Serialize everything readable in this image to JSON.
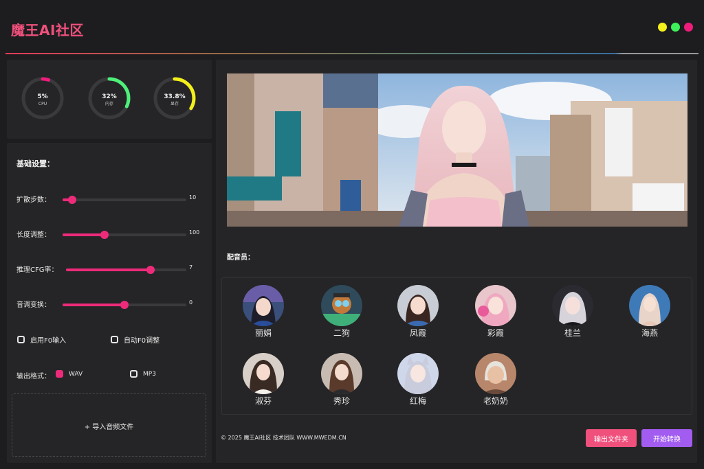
{
  "app": {
    "title": "魔王AI社区"
  },
  "window_controls": [
    {
      "name": "yellow",
      "color": "#f3f01c"
    },
    {
      "name": "green",
      "color": "#3ef05a"
    },
    {
      "name": "pink",
      "color": "#f01c7c"
    }
  ],
  "gauges": [
    {
      "value": "5%",
      "label": "CPU",
      "percent": 5,
      "color": "#f01c7c"
    },
    {
      "value": "32%",
      "label": "内存",
      "percent": 32,
      "color": "#4ef07a"
    },
    {
      "value": "33.8%",
      "label": "显存",
      "percent": 33.8,
      "color": "#f3f01c"
    }
  ],
  "settings": {
    "title": "基础设置：",
    "sliders": [
      {
        "label": "扩散步数：",
        "value": "10",
        "fraction": 0.08
      },
      {
        "label": "长度调整：",
        "value": "100",
        "fraction": 0.34
      },
      {
        "label": "推理CFG率：",
        "value": "7",
        "fraction": 0.7
      },
      {
        "label": "音调变换：",
        "value": "0",
        "fraction": 0.5
      }
    ],
    "checkboxes": [
      {
        "label": "启用F0输入",
        "checked": false
      },
      {
        "label": "自动F0调整",
        "checked": false
      }
    ],
    "output_format": {
      "label": "输出格式：",
      "options": [
        {
          "label": "WAV",
          "selected": true
        },
        {
          "label": "MP3",
          "selected": false
        }
      ]
    },
    "import_label": "+ 导入音频文件"
  },
  "voice_section": {
    "title": "配音员：",
    "voices": [
      {
        "name": "丽娟",
        "avatar": "anime-girl-avatar"
      },
      {
        "name": "二狗",
        "avatar": "robot-cartoon-avatar"
      },
      {
        "name": "凤霞",
        "avatar": "girl-denim-avatar"
      },
      {
        "name": "彩霞",
        "avatar": "pink-hair-girl-avatar"
      },
      {
        "name": "桂兰",
        "avatar": "silver-hair-girl-avatar"
      },
      {
        "name": "海燕",
        "avatar": "blonde-girl-avatar"
      },
      {
        "name": "淑芬",
        "avatar": "dark-hair-girl-avatar"
      },
      {
        "name": "秀珍",
        "avatar": "brown-hair-girl-avatar"
      },
      {
        "name": "红梅",
        "avatar": "cat-ear-girl-avatar"
      },
      {
        "name": "老奶奶",
        "avatar": "grandma-avatar"
      }
    ]
  },
  "footer": {
    "copyright": "© 2025 魔王AI社区 技术团队 WWW.MWEDM.CN",
    "output_folder_button": "输出文件夹",
    "start_button": "开始转换"
  },
  "colors": {
    "accent": "#ee2b7b",
    "button_folder": "#f0507c",
    "button_start": "#a25cf0",
    "background": "#1d1d1f",
    "panel": "#252527"
  }
}
